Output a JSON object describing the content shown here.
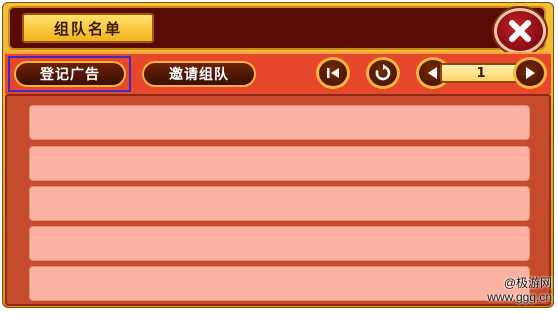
{
  "window": {
    "title": "组队名单",
    "close_icon": "close-icon"
  },
  "toolbar": {
    "register_ad_label": "登记广告",
    "invite_team_label": "邀请组队",
    "first_page_icon": "first-page-icon",
    "refresh_icon": "refresh-icon",
    "prev_page_icon": "prev-page-icon",
    "next_page_icon": "next-page-icon",
    "page_number": "1"
  },
  "team_list": {
    "rows": [
      "",
      "",
      "",
      "",
      ""
    ]
  },
  "watermark": {
    "line1": "@极游网",
    "line2": "www.ggg.cn"
  },
  "colors": {
    "frame_gold": "#f3c13a",
    "title_bar": "#5a0b06",
    "toolbar_red": "#e7472b",
    "list_bg": "#c64a2c",
    "row_pink": "#fbb2a0",
    "selection_outline": "#3d28c8"
  }
}
